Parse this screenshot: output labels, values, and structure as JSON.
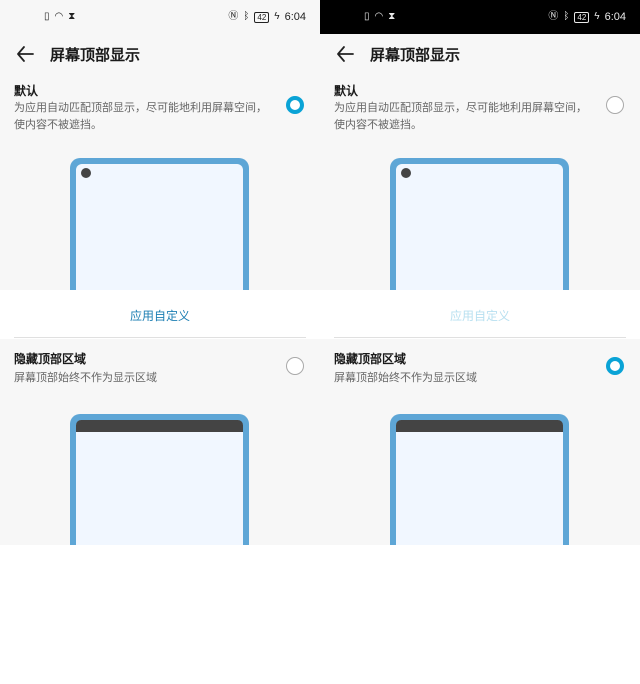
{
  "status_bar": {
    "time": "6:04",
    "battery": "42"
  },
  "header": {
    "title": "屏幕顶部显示"
  },
  "options": {
    "default": {
      "title": "默认",
      "description": "为应用自动匹配顶部显示，尽可能地利用屏幕空间，使内容不被遮挡。"
    },
    "hide": {
      "title": "隐藏顶部区域",
      "description": "屏幕顶部始终不作为显示区域"
    }
  },
  "custom_link": {
    "label": "应用自定义"
  },
  "panels": {
    "left_selected": "default",
    "right_selected": "hide"
  },
  "colors": {
    "accent": "#0aa3d6",
    "link_enabled": "#1d7fb3",
    "link_disabled": "#b8e0f0",
    "phone_frame": "#5ea6d6"
  }
}
